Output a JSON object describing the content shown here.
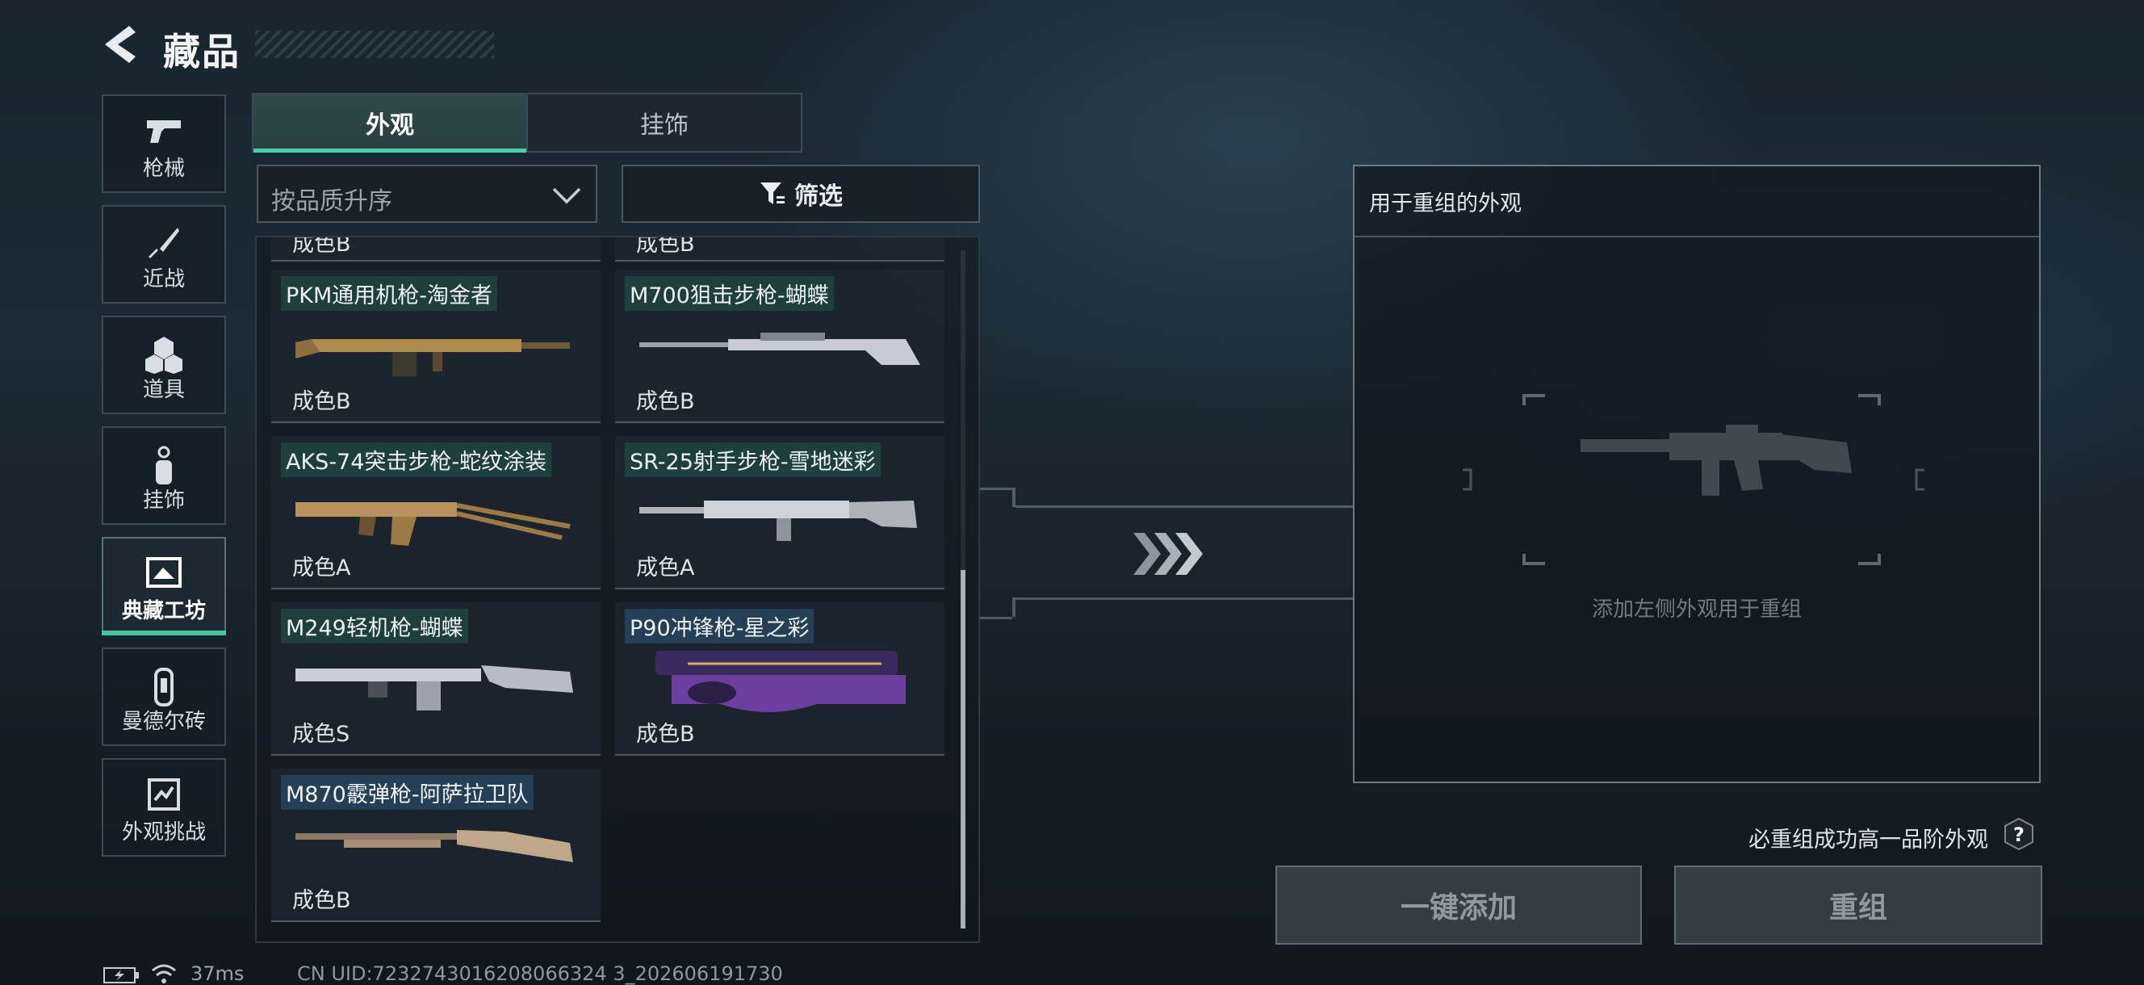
{
  "header": {
    "title": "藏品"
  },
  "sidebar": {
    "items": [
      {
        "label": "枪械",
        "icon": "pistol-icon"
      },
      {
        "label": "近战",
        "icon": "knife-icon"
      },
      {
        "label": "道具",
        "icon": "grenade-cluster-icon"
      },
      {
        "label": "挂饰",
        "icon": "charm-icon"
      },
      {
        "label": "典藏工坊",
        "icon": "workshop-icon",
        "active": true
      },
      {
        "label": "曼德尔砖",
        "icon": "mandel-brick-icon"
      },
      {
        "label": "外观挑战",
        "icon": "challenge-icon"
      }
    ]
  },
  "tabs": [
    {
      "label": "外观",
      "active": true
    },
    {
      "label": "挂饰",
      "active": false
    }
  ],
  "filters": {
    "sort_label": "按品质升序",
    "filter_label": "筛选"
  },
  "cards": [
    {
      "name": "",
      "quality": "成色B",
      "partial": true
    },
    {
      "name": "",
      "quality": "成色B",
      "partial": true
    },
    {
      "name": "PKM通用机枪-淘金者",
      "quality": "成色B",
      "skin_color": "#b08a4a"
    },
    {
      "name": "M700狙击步枪-蝴蝶",
      "quality": "成色B",
      "skin_color": "#c6ccd6"
    },
    {
      "name": "AKS-74突击步枪-蛇纹涂装",
      "quality": "成色A",
      "skin_color": "#b8915a"
    },
    {
      "name": "SR-25射手步枪-雪地迷彩",
      "quality": "成色A",
      "skin_color": "#cfd3d8"
    },
    {
      "name": "M249轻机枪-蝴蝶",
      "quality": "成色S",
      "skin_color": "#c9ced8"
    },
    {
      "name": "P90冲锋枪-星之彩",
      "quality": "成色B",
      "skin_color": "#6a3f9e"
    },
    {
      "name": "M870霰弹枪-阿萨拉卫队",
      "quality": "成色B",
      "skin_color": "#a88f74"
    }
  ],
  "recombine": {
    "title": "用于重组的外观",
    "hint": "添加左侧外观用于重组",
    "note": "必重组成功高一品阶外观",
    "add_all_label": "一键添加",
    "recombine_label": "重组"
  },
  "status": {
    "ping": "37ms",
    "uid": "CN UID:7232743016208066324 3_202606191730"
  },
  "colors": {
    "accent": "#3ec9a0",
    "panel_border": "#3a4a56"
  }
}
